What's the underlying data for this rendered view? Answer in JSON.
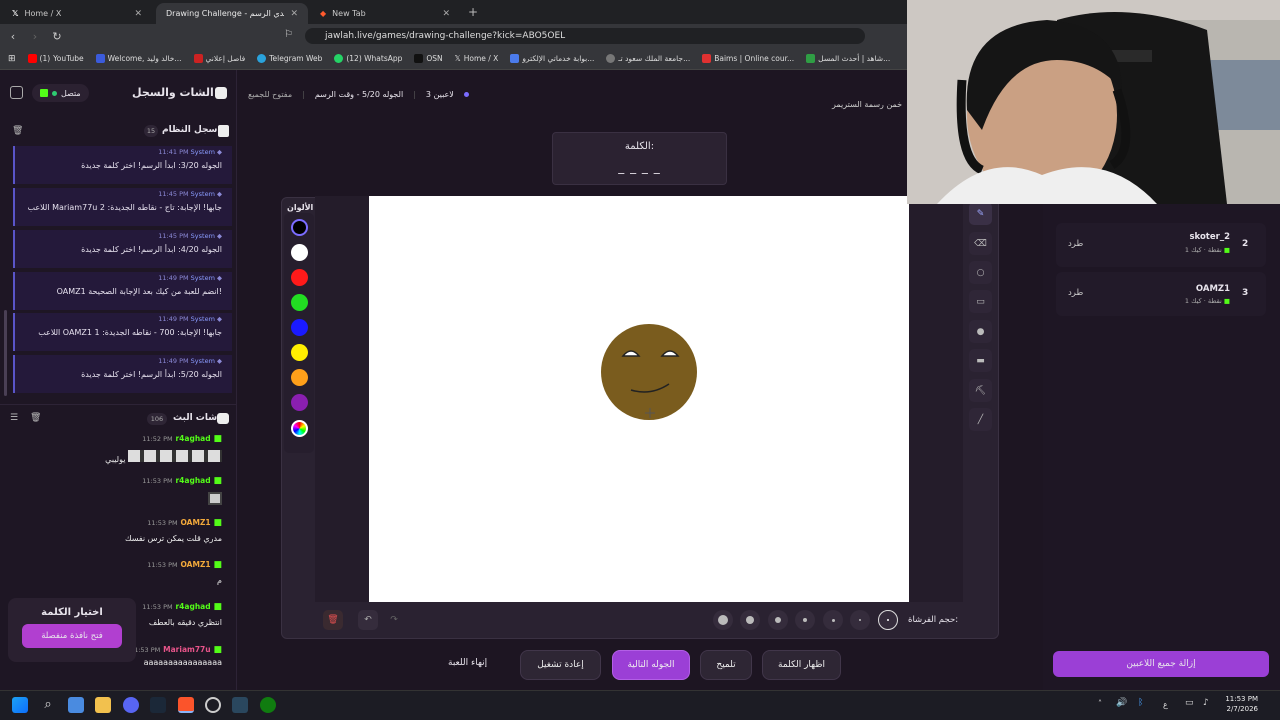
{
  "browser": {
    "tabs": [
      {
        "label": "Home / X"
      },
      {
        "label": "Drawing Challenge - تحدي الرسم"
      },
      {
        "label": "New Tab"
      }
    ],
    "url": "jawlah.live/games/drawing-challenge?kick=ABO5OEL",
    "bookmarks": [
      "YouTube",
      "Welcome, خالد وليد...",
      "فاصل إعلاني",
      "Telegram Web",
      "(12) WhatsApp",
      "OSN",
      "Home / X",
      "بوابة خدماتي الإلكترو...",
      "جامعة الملك سعود تـ...",
      "Baims | Online cour...",
      "شاهد | أحدث المسل..."
    ],
    "youtube_count": "(1)"
  },
  "header": {
    "players_count": "3 لاعبين",
    "round_info": "الجوله 5/20 - وقت الرسم",
    "open_to_all": "مفتوح للجميع",
    "guess_prompt": "خمن رسمة الستريمر"
  },
  "left": {
    "title": "الشات والسجل",
    "status": "متصل",
    "system_log_title": "سجل النظام",
    "system_log_count": "15",
    "system_messages": [
      {
        "sender": "System",
        "time": "11:41 PM",
        "text": "الجوله 3/20: ابدأ الرسم! اختر كلمة جديدة"
      },
      {
        "sender": "System",
        "time": "11:45 PM",
        "text": "اللاعب Mariam77u جابها! الإجابة: تاج - نقاطه الجديدة: 2"
      },
      {
        "sender": "System",
        "time": "11:45 PM",
        "text": "الجوله 4/20: ابدأ الرسم! اختر كلمة جديدة"
      },
      {
        "sender": "System",
        "time": "11:49 PM",
        "text": "OAMZ1 انضم للعبة من كيك بعد الإجابة الصحيحة!"
      },
      {
        "sender": "System",
        "time": "11:49 PM",
        "text": "اللاعب OAMZ1 جابها! الإجابة: 700 - نقاطه الجديدة: 1"
      },
      {
        "sender": "System",
        "time": "11:49 PM",
        "text": "الجوله 5/20: ابدأ الرسم! اختر كلمة جديدة"
      }
    ],
    "stream_chat_title": "شات البث",
    "stream_chat_count": "106",
    "chat_messages": [
      {
        "sender": "r4aghad",
        "time": "11:52 PM",
        "text": "يوليبي"
      },
      {
        "sender": "r4aghad",
        "time": "11:53 PM",
        "text": ""
      },
      {
        "sender": "OAMZ1",
        "time": "11:53 PM",
        "text": "مدري قلت يمكن ترس نفسك"
      },
      {
        "sender": "OAMZ1",
        "time": "11:53 PM",
        "text": "م"
      },
      {
        "sender": "r4aghad",
        "time": "11:53 PM",
        "text": "انتظري دقيقه بالعطف"
      },
      {
        "sender": "Mariam77u",
        "time": "11:53 PM",
        "text": "aaaaaaaaaaaaaaaa"
      }
    ],
    "choose_word_title": "اختيار الكلمة",
    "open_window_label": "فتح نافذة منفصلة"
  },
  "center": {
    "word_label": "الكلمة:",
    "word_mask": "_ _ _ _",
    "colors_label": "الألوان",
    "palette": [
      "#000000",
      "#ffffff",
      "#ff1a1a",
      "#22dd22",
      "#1a1aff",
      "#ffee00",
      "#ff9f1a",
      "#8a1fb0"
    ],
    "brush_size_label": "حجم الفرشاة:",
    "buttons": {
      "end_game": "إنهاء اللعبة",
      "restart": "إعادة تشغيل",
      "next_round": "الجوله التالية",
      "hint": "تلميح",
      "show_word": "اظهار الكلمة"
    }
  },
  "right": {
    "players": [
      {
        "rank": "2",
        "name": "skoter_2",
        "platform": "كيك",
        "points": "1 نقطة",
        "kick_label": "طرد"
      },
      {
        "rank": "3",
        "name": "OAMZ1",
        "platform": "كيك",
        "points": "1 نقطة",
        "kick_label": "طرد"
      }
    ],
    "remove_all_label": "إزالة جميع اللاعبين"
  },
  "taskbar": {
    "time": "11:53 PM",
    "date": "2/7/2026",
    "lang": "ع"
  },
  "colors": {
    "accent": "#9b3fd6",
    "kick_green": "#53fc18",
    "system_blue": "#5a55c8"
  }
}
